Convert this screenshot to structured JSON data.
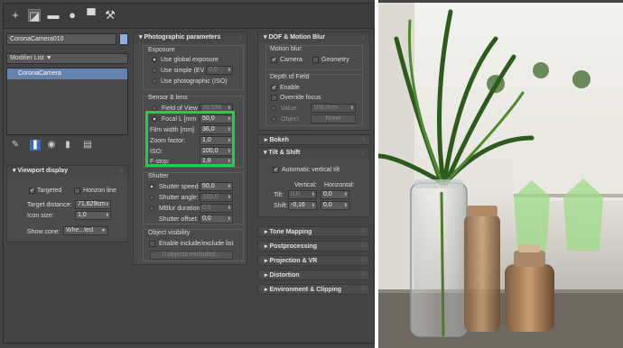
{
  "toolbar": {
    "icons": [
      "create-icon",
      "modify-icon",
      "hierarchy-icon",
      "motion-icon",
      "display-icon",
      "utilities-icon"
    ],
    "glyphs": [
      "+",
      "◪",
      "▬",
      "●",
      "▀",
      "⚒"
    ]
  },
  "object": {
    "name": "CoronaCamera010",
    "color": "#8fb0e6"
  },
  "modifier_list": {
    "label": "Modifier List"
  },
  "stack": {
    "items": [
      "CoronaCamera"
    ]
  },
  "viewport_display": {
    "title": "Viewport display",
    "targeted": "Targeted",
    "horizon_line": "Horizon line",
    "target_distance_label": "Target distance:",
    "target_distance_value": "71,629cm",
    "icon_size_label": "Icon size:",
    "icon_size_value": "1,0",
    "show_cone_label": "Show cone:",
    "show_cone_value": "Whe...ted"
  },
  "photographic": {
    "title": "Photographic parameters",
    "exposure_title": "Exposure",
    "use_global": "Use global exposure",
    "use_simple": "Use simple (EV",
    "use_simple_value": "0,0",
    "use_photographic": "Use photographic (ISO)",
    "sensor_title": "Sensor & lens",
    "fov_label": "Field of View",
    "fov_value": "39,598",
    "focal_label": "Focal L [mm",
    "focal_value": "50,0",
    "film_label": "Film width [mm]",
    "film_value": "36,0",
    "zoom_label": "Zoom factor:",
    "zoom_value": "1,0",
    "iso_label": "ISO:",
    "iso_value": "100,0",
    "fstop_label": "F-stop:",
    "fstop_value": "1,8",
    "shutter_title": "Shutter",
    "shutter_speed_label": "Shutter speed",
    "shutter_speed_value": "50,0",
    "shutter_angle_label": "Shutter angle:",
    "shutter_angle_value": "180,0",
    "mblur_label": "MBlur duration:",
    "mblur_value": "0,5",
    "shutter_offset_label": "Shutter offset:",
    "shutter_offset_value": "0,0",
    "visibility_title": "Object visibility",
    "enable_include": "Enable include/exclude list",
    "objects_excluded": "0 objects excluded..."
  },
  "dof": {
    "title": "DOF & Motion Blur",
    "motion_blur": "Motion blur:",
    "camera": "Camera",
    "geometry": "Geometry",
    "dof_title": "Depth of Field",
    "enable": "Enable",
    "override_focus": "Override focus",
    "value_label": "Value:",
    "value_value": "108,0cm",
    "object_label": "Object",
    "none_label": "None"
  },
  "bokeh": {
    "title": "Bokeh"
  },
  "tilt": {
    "title": "Tilt & Shift",
    "auto_vertical": "Automatic vertical tilt",
    "vertical": "Vertical:",
    "horizontal": "Horizontal:",
    "tilt_label": "Tilt:",
    "tilt_v": "0,0",
    "tilt_h": "0,0",
    "shift_label": "Shift:",
    "shift_v": "-0,16",
    "shift_h": "0,0"
  },
  "rollouts": [
    "Tone Mapping",
    "Postprocessing",
    "Projection & VR",
    "Distortion",
    "Environment & Clipping"
  ],
  "colors": {
    "highlight": "#1fd14a",
    "selection": "#6382ad"
  }
}
